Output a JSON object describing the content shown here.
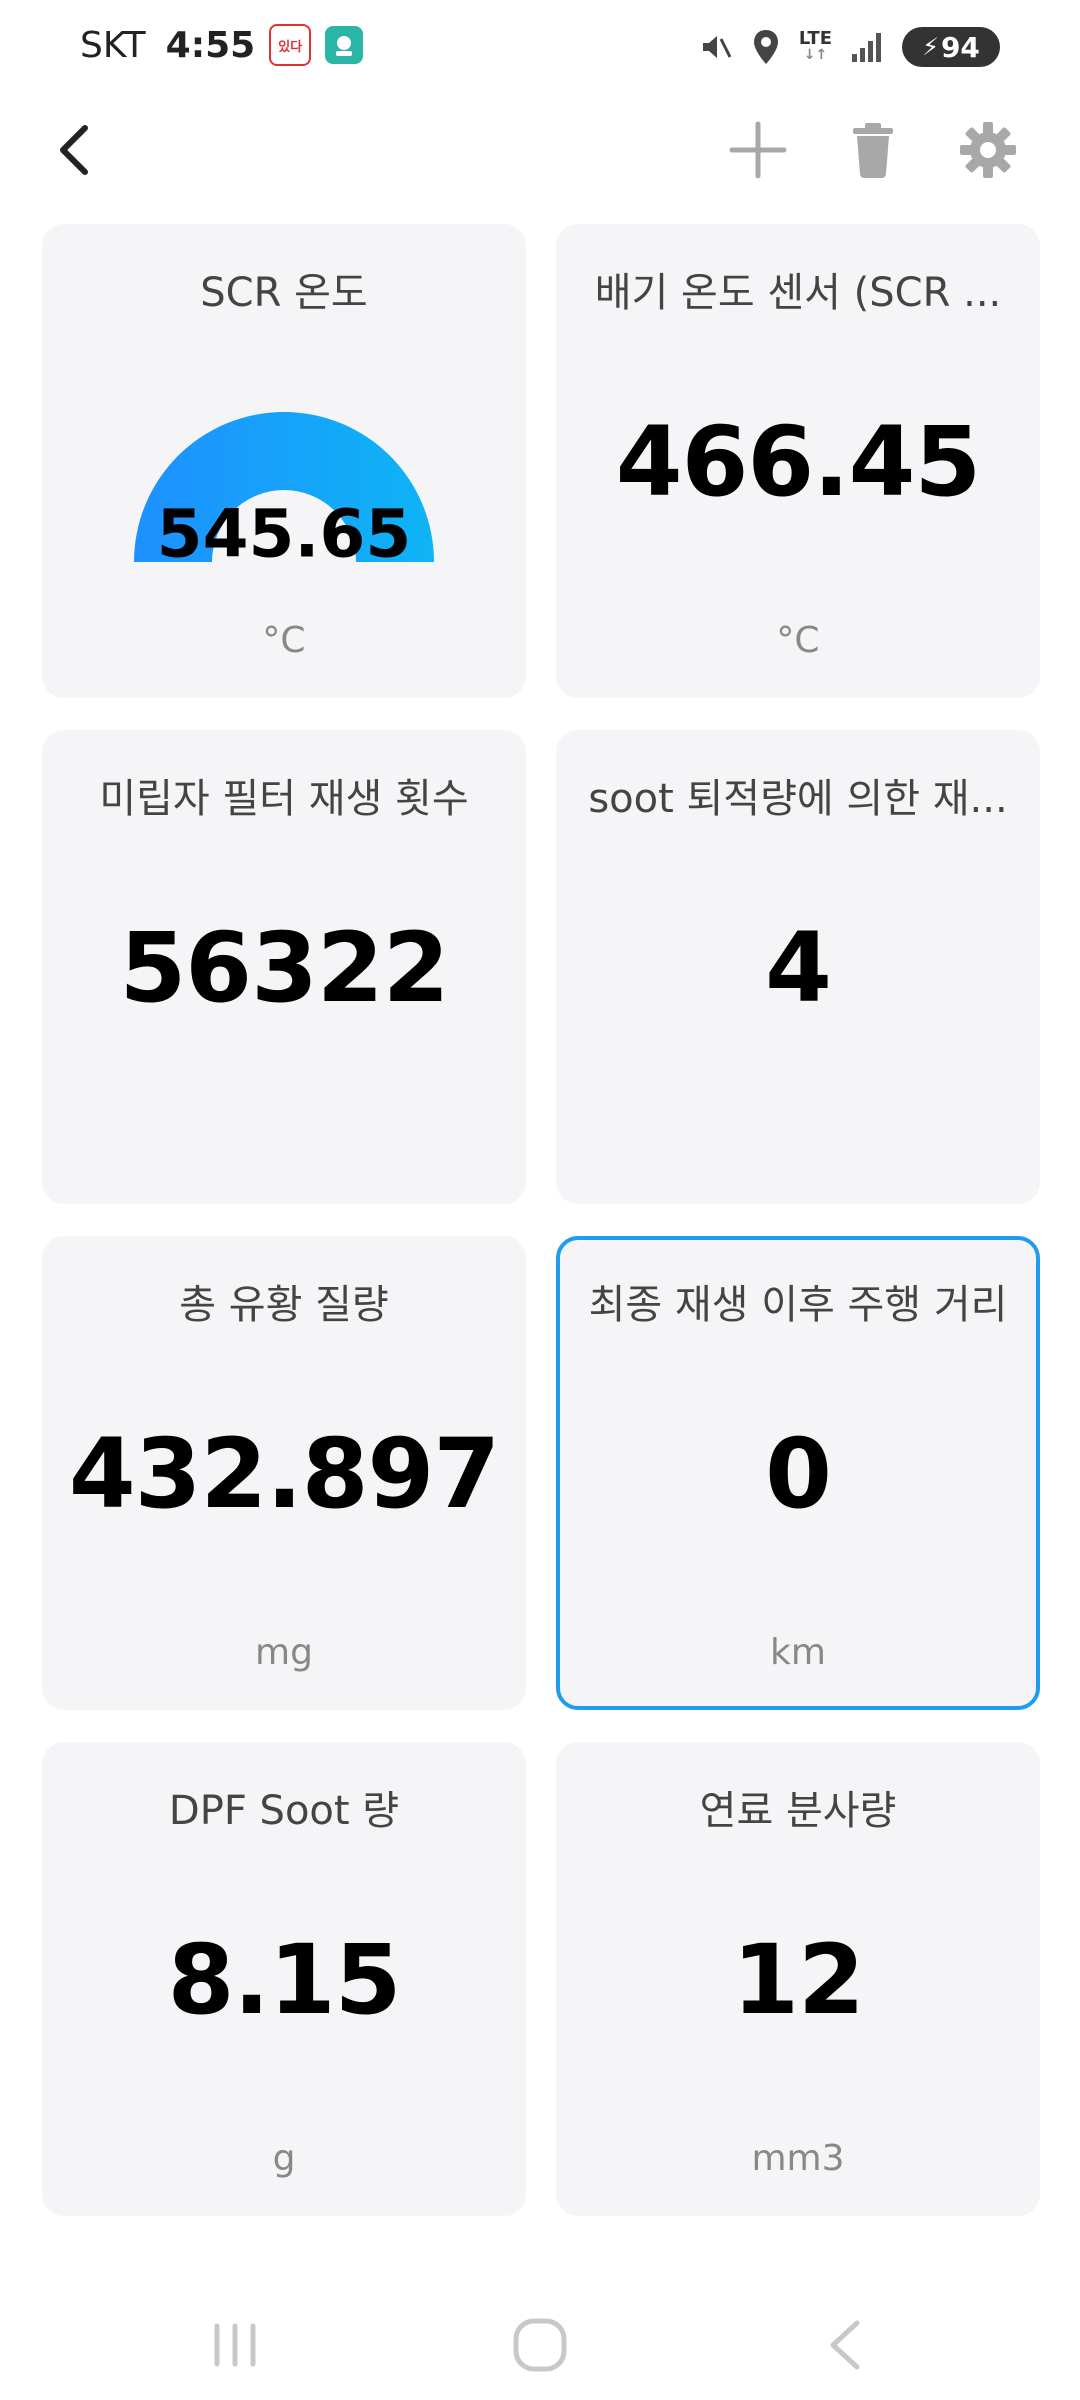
{
  "status": {
    "carrier": "SKT",
    "time": "4:55",
    "badge1_text": "있다",
    "lte": "LTE",
    "battery": "94"
  },
  "appbar": {
    "back_icon": "chevron-left-icon",
    "add_icon": "plus-icon",
    "delete_icon": "trash-icon",
    "settings_icon": "gear-icon"
  },
  "cards": [
    {
      "title": "SCR 온도",
      "value": "545.65",
      "unit": "°C",
      "type": "gauge",
      "gauge_fill": 1.0
    },
    {
      "title": "배기 온도 센서 (SCR ...",
      "value": "466.45",
      "unit": "°C"
    },
    {
      "title": "미립자 필터 재생 횟수",
      "value": "56322",
      "unit": ""
    },
    {
      "title": "soot 퇴적량에 의한 재...",
      "value": "4",
      "unit": ""
    },
    {
      "title": "총 유황 질량",
      "value": "432.897",
      "unit": "mg"
    },
    {
      "title": "최종 재생 이후 주행 거리",
      "value": "0",
      "unit": "km",
      "selected": true
    },
    {
      "title": "DPF Soot 량",
      "value": "8.15",
      "unit": "g"
    },
    {
      "title": "연료 분사량",
      "value": "12",
      "unit": "mm3"
    }
  ],
  "colors": {
    "accent": "#1f9cf0",
    "gauge_start": "#1e90ff",
    "gauge_end": "#0fb4f5",
    "card_bg": "#f5f5f7"
  },
  "nav": {
    "recent_icon": "recent-apps-icon",
    "home_icon": "home-icon",
    "back_icon": "nav-back-icon"
  }
}
